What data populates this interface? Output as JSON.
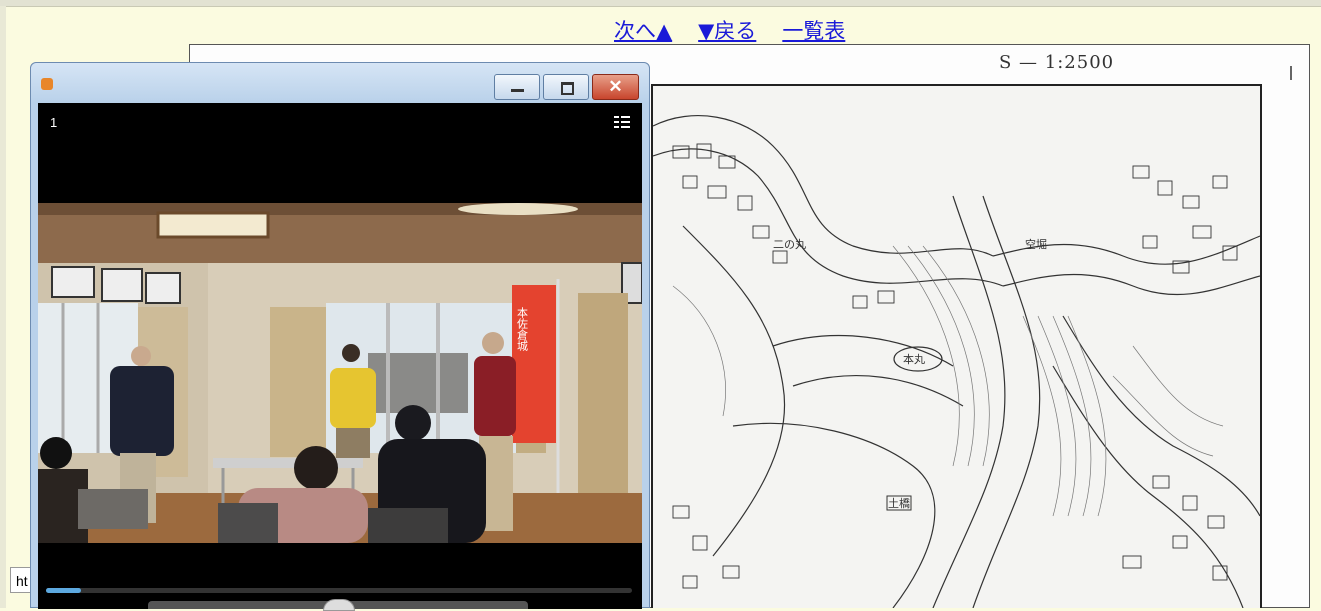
{
  "nav": {
    "next_label": "次へ▲",
    "back_label": "▼戻る",
    "list_label": "一覧表"
  },
  "map": {
    "scale_text": "S — 1:2500",
    "labels": {
      "ninomaru": "二の丸",
      "honmaru": "本丸",
      "karabori": "空堀",
      "dobashi": "土橋"
    }
  },
  "url_bar": {
    "text": "ht"
  },
  "player": {
    "frame_number": "1",
    "banner_text": "本佐倉城",
    "progress": 0.06,
    "icons": {
      "app": "player-app-icon",
      "minimize": "minimize-icon",
      "maximize": "maximize-icon",
      "close": "close-icon",
      "playlist": "playlist-icon"
    }
  },
  "colors": {
    "page_bg": "#fbfbe0",
    "link": "#1a1ad8",
    "titlebar": "#b9d1ea",
    "close_button": "#c8452d",
    "seek_fill": "#5da9e0"
  }
}
